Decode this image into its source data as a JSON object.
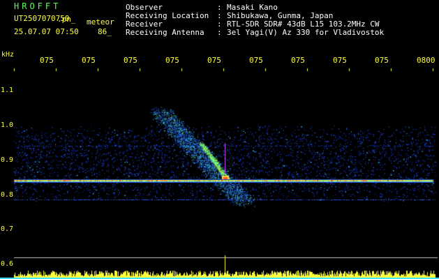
{
  "header": {
    "app_title": "HROFFT",
    "file_name": "UT2507070750",
    "file_ext": ".pn_",
    "event_type": "meteor",
    "timestamp": "25.07.07 07:50",
    "event_count": "86_"
  },
  "metadata": [
    {
      "label": "Observer",
      "value": "Masaki Kano"
    },
    {
      "label": "Receiving Location",
      "value": "Shibukawa, Gunma, Japan"
    },
    {
      "label": "Receiver",
      "value": "RTL-SDR SDR# 43dB L15 103.2MHz CW"
    },
    {
      "label": "Receiving Antenna",
      "value": "3el Yagi(V) Az 330 for Vladivostok"
    }
  ],
  "spectrogram": {
    "y_unit": "kHz",
    "y_ticks": [
      "1.1",
      "1.0",
      "0.9",
      "0.8",
      "0.7",
      "0.6"
    ],
    "x_ticks": [
      "075",
      "075",
      "075",
      "075",
      "075",
      "075",
      "075",
      "075",
      "075",
      "0800"
    ],
    "carrier_khz": 0.84,
    "colors": {
      "background": "#000000",
      "noise": "#1a3cc8",
      "carrier": "#ff3c00",
      "header_green": "#5cff5c",
      "header_yellow": "#ffff3c",
      "gridline": "#d0d0d0"
    }
  }
}
